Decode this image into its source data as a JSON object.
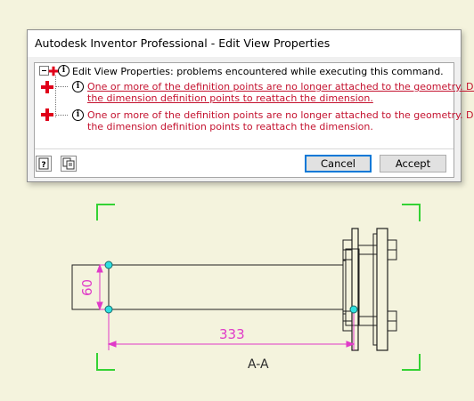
{
  "window": {
    "title": "Autodesk Inventor Professional - Edit View Properties"
  },
  "messages": {
    "root_text": "Edit View Properties: problems encountered while executing this command.",
    "errors": [
      {
        "line1": "One or more of the definition points are no longer attached to the geometry.  Drag",
        "line2": "the dimension definition points to reattach the dimension."
      },
      {
        "line1": "One or more of the definition points are no longer attached to the geometry.  Drag",
        "line2": "the dimension definition points to reattach the dimension."
      }
    ]
  },
  "buttons": {
    "cancel": "Cancel",
    "accept": "Accept",
    "help_icon": "help-icon",
    "copy_icon": "copy-icon"
  },
  "drawing": {
    "dim_vertical": "60",
    "dim_horizontal": "333",
    "view_label": "A-A",
    "colors": {
      "background": "#f4f3dd",
      "geometry": "#1f1f1f",
      "dimension": "#e03ac8",
      "corner_marks": "#34d234",
      "point_marker": "#2ee0e0",
      "error": "#c4122f"
    }
  }
}
